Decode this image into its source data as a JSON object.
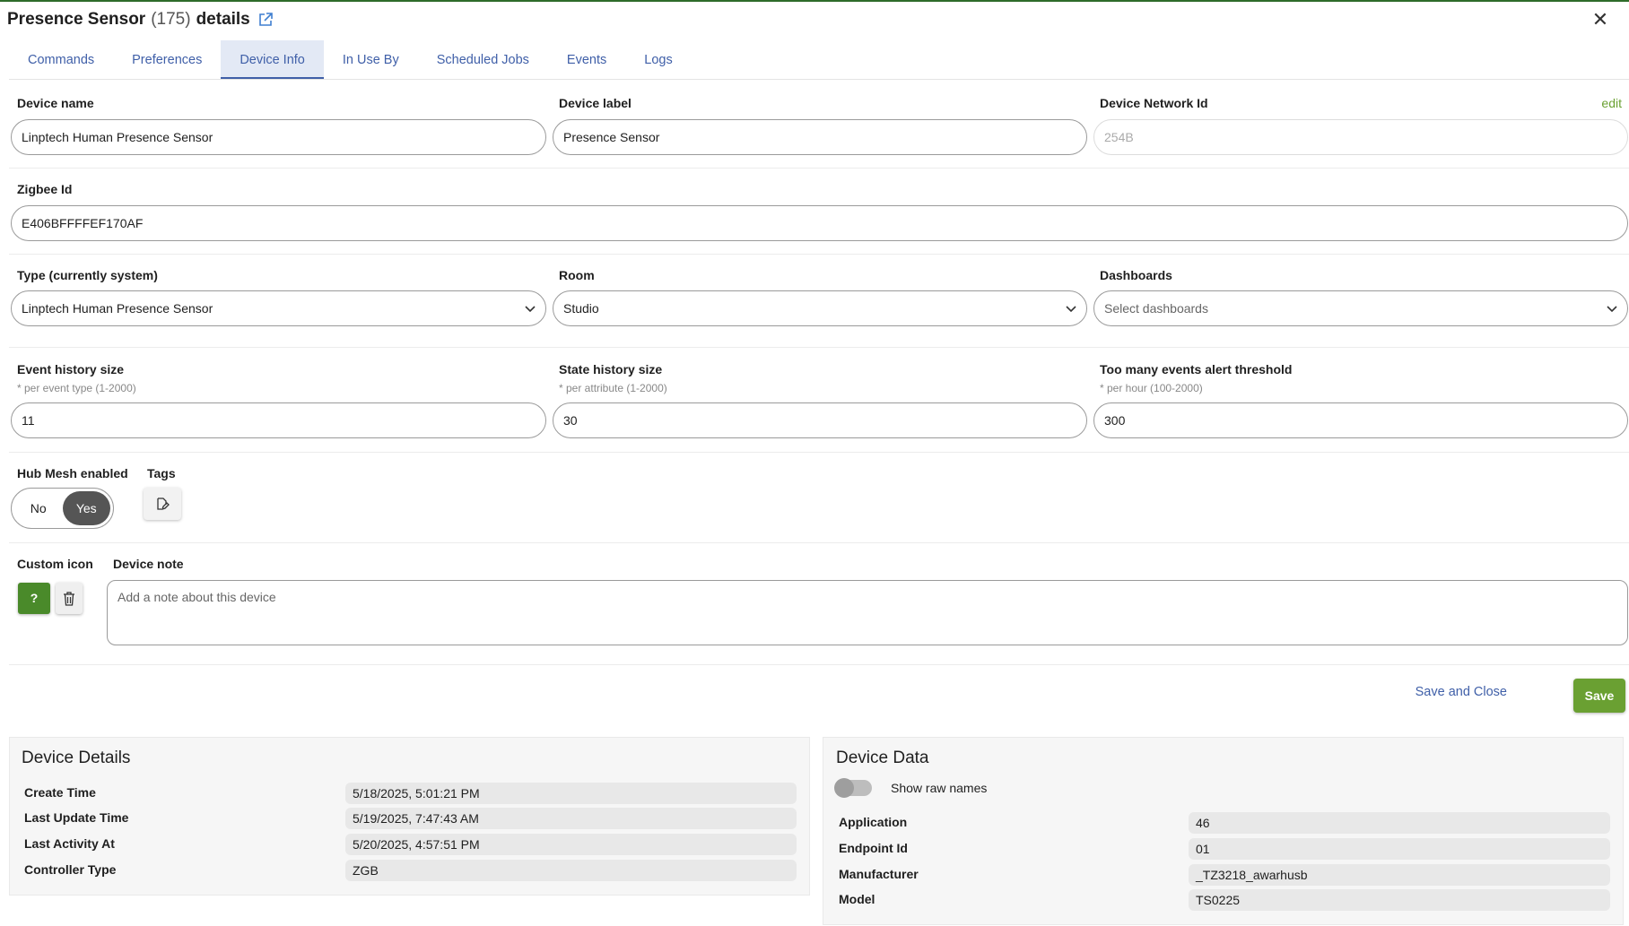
{
  "header": {
    "device_name": "Presence Sensor",
    "count": "(175)",
    "suffix": "details"
  },
  "tabs": [
    {
      "label": "Commands"
    },
    {
      "label": "Preferences"
    },
    {
      "label": "Device Info"
    },
    {
      "label": "In Use By"
    },
    {
      "label": "Scheduled Jobs"
    },
    {
      "label": "Events"
    },
    {
      "label": "Logs"
    }
  ],
  "form": {
    "device_name_label": "Device name",
    "device_name_value": "Linptech Human Presence Sensor",
    "device_label_label": "Device label",
    "device_label_value": "Presence Sensor",
    "network_id_label": "Device Network Id",
    "network_id_value": "254B",
    "edit_label": "edit",
    "zigbee_label": "Zigbee Id",
    "zigbee_value": "E406BFFFFEF170AF",
    "type_label": "Type (currently system)",
    "type_value": "Linptech Human Presence Sensor",
    "room_label": "Room",
    "room_value": "Studio",
    "dashboards_label": "Dashboards",
    "dashboards_placeholder": "Select dashboards",
    "event_history_label": "Event history size",
    "event_history_hint": "* per event type (1-2000)",
    "event_history_value": "11",
    "state_history_label": "State history size",
    "state_history_hint": "* per attribute (1-2000)",
    "state_history_value": "30",
    "threshold_label": "Too many events alert threshold",
    "threshold_hint": "* per hour (100-2000)",
    "threshold_value": "300",
    "hub_mesh_label": "Hub Mesh enabled",
    "hub_mesh_no": "No",
    "hub_mesh_yes": "Yes",
    "tags_label": "Tags",
    "custom_icon_label": "Custom icon",
    "custom_icon_glyph": "?",
    "device_note_label": "Device note",
    "device_note_placeholder": "Add a note about this device",
    "save_and_close": "Save and Close",
    "save": "Save"
  },
  "device_details": {
    "title": "Device Details",
    "rows": [
      {
        "label": "Create Time",
        "value": "5/18/2025, 5:01:21 PM"
      },
      {
        "label": "Last Update Time",
        "value": "5/19/2025, 7:47:43 AM"
      },
      {
        "label": "Last Activity At",
        "value": "5/20/2025, 4:57:51 PM"
      },
      {
        "label": "Controller Type",
        "value": "ZGB"
      }
    ]
  },
  "device_data": {
    "title": "Device Data",
    "show_raw_names": "Show raw names",
    "rows": [
      {
        "label": "Application",
        "value": "46"
      },
      {
        "label": "Endpoint Id",
        "value": "01"
      },
      {
        "label": "Manufacturer",
        "value": "_TZ3218_awarhusb"
      },
      {
        "label": "Model",
        "value": "TS0225"
      }
    ]
  },
  "colors": {
    "accent_green": "#6aa032",
    "tab_blue": "#3f5fa8",
    "icon_green": "#4a8a2a"
  },
  "icons": [
    "external-link-icon",
    "close-icon",
    "chevron-down-icon",
    "edit-tag-icon",
    "trash-icon"
  ]
}
